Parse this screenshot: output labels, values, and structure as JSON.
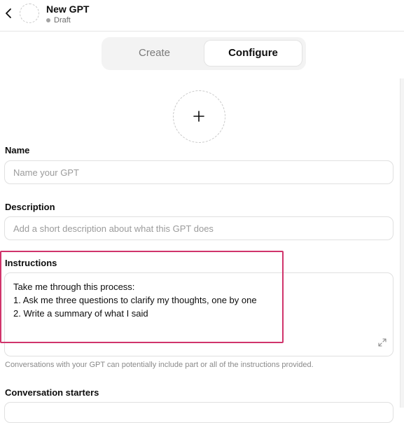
{
  "header": {
    "title": "New GPT",
    "status": "Draft"
  },
  "tabs": [
    {
      "label": "Create",
      "active": false
    },
    {
      "label": "Configure",
      "active": true
    }
  ],
  "name_field": {
    "label": "Name",
    "placeholder": "Name your GPT",
    "value": ""
  },
  "description_field": {
    "label": "Description",
    "placeholder": "Add a short description about what this GPT does",
    "value": ""
  },
  "instructions_field": {
    "label": "Instructions",
    "value": "Take me through this process:\n1. Ask me three questions to clarify my thoughts, one by one\n2. Write a summary of what I said",
    "hint": "Conversations with your GPT can potentially include part or all of the instructions provided."
  },
  "conversation_starters": {
    "label": "Conversation starters"
  },
  "colors": {
    "highlight": "#d0346b",
    "tab_bg": "#f3f3f3",
    "border": "#e0e0e0"
  }
}
